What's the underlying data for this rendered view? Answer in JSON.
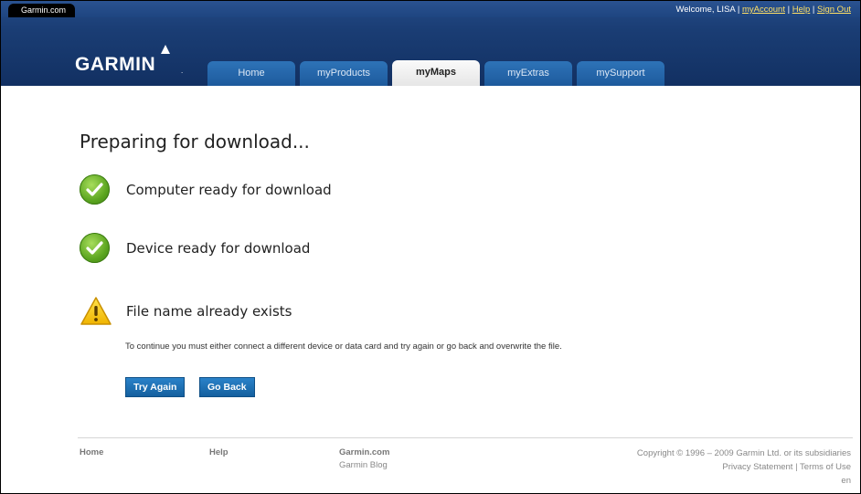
{
  "header": {
    "site_tab": "Garmin.com",
    "welcome": "Welcome, LISA",
    "links": [
      "myAccount",
      "Help",
      "Sign Out"
    ],
    "logo": "GARMIN",
    "tabs": [
      {
        "label": "Home",
        "active": false
      },
      {
        "label": "myProducts",
        "active": false
      },
      {
        "label": "myMaps",
        "active": true
      },
      {
        "label": "myExtras",
        "active": false
      },
      {
        "label": "mySupport",
        "active": false
      }
    ]
  },
  "main": {
    "title": "Preparing for download...",
    "statuses": [
      {
        "icon": "check-icon",
        "text": "Computer ready for download"
      },
      {
        "icon": "check-icon",
        "text": "Device ready for download"
      },
      {
        "icon": "warning-icon",
        "text": "File name already exists"
      }
    ],
    "message": "To continue you must either connect a different device or data card and try again or go back and overwrite the file.",
    "buttons": {
      "try_again": "Try Again",
      "go_back": "Go Back"
    }
  },
  "footer": {
    "home": "Home",
    "help": "Help",
    "garmin_com": "Garmin.com",
    "garmin_blog": "Garmin Blog",
    "copyright": "Copyright © 1996 – 2009 Garmin Ltd. or its subsidiaries",
    "privacy": "Privacy Statement",
    "terms": "Terms of Use",
    "language": "en"
  },
  "colors": {
    "header": "#1a3d74",
    "tab": "#1d5a9c",
    "button": "#1a6fb3",
    "check": "#5aa41f",
    "warning": "#f2c200"
  }
}
